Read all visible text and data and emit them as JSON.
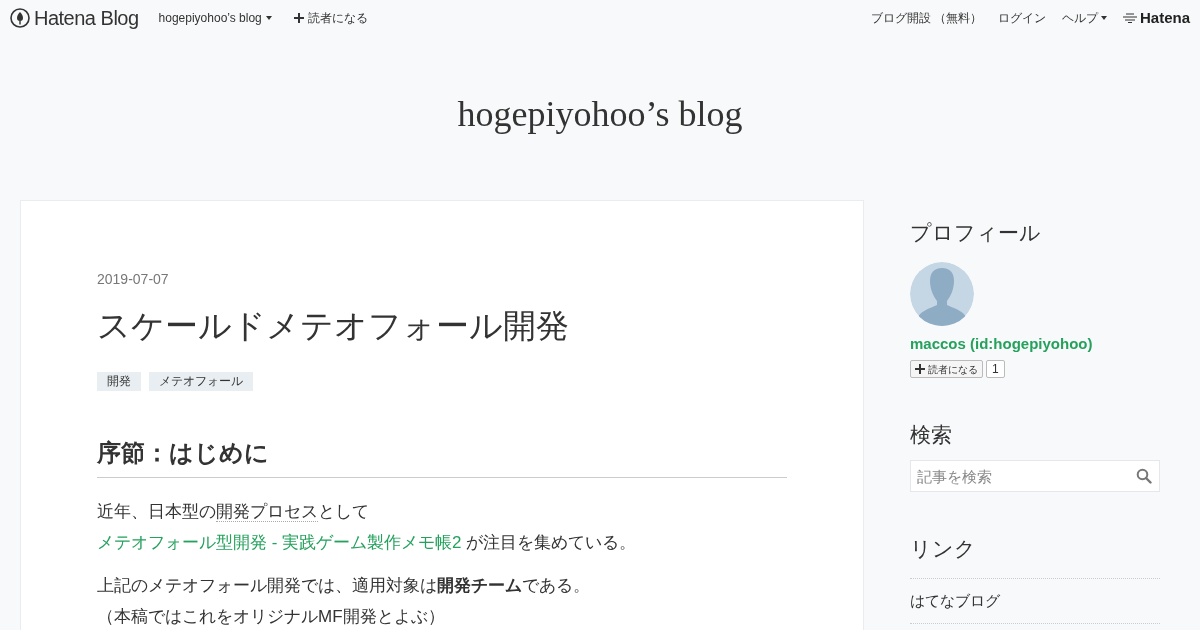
{
  "navbar": {
    "logo": "Hatena Blog",
    "left_items": [
      {
        "kind": "menu",
        "label": "hogepiyohoo’s blog"
      },
      {
        "kind": "plus",
        "label": "読者になる"
      }
    ],
    "right_items": [
      {
        "kind": "link",
        "label": "ブログ開設 （無料）"
      },
      {
        "kind": "link",
        "label": "ログイン"
      },
      {
        "kind": "menu",
        "label": "ヘルプ"
      }
    ],
    "brand": "Hatena"
  },
  "blog_title": "hogepiyohoo’s blog",
  "article": {
    "date": "2019-07-07",
    "title": "スケールドメテオフォール開発",
    "tags": [
      "開発",
      "メテオフォール"
    ],
    "heading": "序節：はじめに",
    "paragraphs": [
      {
        "lines": [
          [
            {
              "kind": "text",
              "text": "近年、日本型の"
            },
            {
              "kind": "keyword",
              "text": "開発プロセス"
            },
            {
              "kind": "text",
              "text": "として"
            }
          ],
          [
            {
              "kind": "link",
              "text": "メテオフォール型開発 - 実践ゲーム製作メモ帳2"
            },
            {
              "kind": "text",
              "text": " が注目を集めている。"
            }
          ]
        ]
      },
      {
        "lines": [
          [
            {
              "kind": "text",
              "text": "上記のメテオフォール開発では、適用対象は**開発チーム**である。"
            }
          ],
          [
            {
              "kind": "text",
              "text": "（本稿ではこれをオリジナルMF開発とよぶ）"
            }
          ]
        ]
      }
    ]
  },
  "sidebar": {
    "profile": {
      "title": "プロフィール",
      "name": "maccos (id:hogepiyohoo)",
      "subscribe": "読者になる",
      "count": "1"
    },
    "search": {
      "title": "検索",
      "placeholder": "記事を検索"
    },
    "links": {
      "title": "リンク",
      "items": [
        "はてなブログ"
      ]
    }
  }
}
